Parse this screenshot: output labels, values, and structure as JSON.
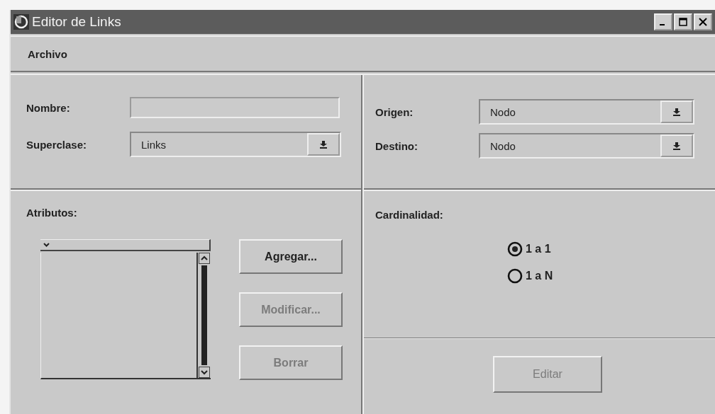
{
  "window": {
    "title": "Editor de Links"
  },
  "menu": [
    {
      "label": "Archivo"
    }
  ],
  "identity": {
    "fields": [
      {
        "kind": "text",
        "label": "Nombre:"
      },
      {
        "kind": "combo",
        "label": "Superclase:",
        "value": "Links"
      }
    ]
  },
  "ends": {
    "fields": [
      {
        "kind": "combo",
        "label": "Origen:",
        "value": "Nodo"
      },
      {
        "kind": "combo",
        "label": "Destino:",
        "value": "Nodo"
      }
    ]
  },
  "attributes": {
    "label": "Atributos:",
    "buttons": [
      {
        "label": "Agregar...",
        "disabled": false
      },
      {
        "label": "Modificar...",
        "disabled": true
      },
      {
        "label": "Borrar",
        "disabled": true
      }
    ]
  },
  "cardinality": {
    "label": "Cardinalidad:",
    "options": [
      {
        "label": "1 a 1",
        "selected": true
      },
      {
        "label": "1 a N",
        "selected": false
      }
    ]
  },
  "edit_button": {
    "label": "Editar",
    "disabled": true
  }
}
